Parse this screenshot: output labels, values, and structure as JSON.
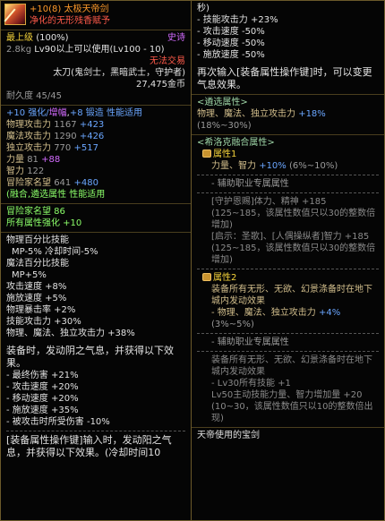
{
  "item": {
    "name": "+10(8) 太极天帝剑",
    "subtitle": "净化的无形残香赋予",
    "level_label": "最上级",
    "level_pct": "(100%)",
    "rarity": "史诗",
    "weight": "2.8kg",
    "use_req": "Lv90以上可以使用(Lv100 - 10)",
    "trade": "无法交易",
    "weapon_type": "太刀(鬼剑士，黑暗武士，守护者)",
    "price": "27,475金币",
    "durability": "耐久度 45/45"
  },
  "enhance": {
    "line1_a": "+10 强化/",
    "line1_b": "增幅",
    "line1_c": ",",
    "line1_d": "+8 锻造",
    "line1_e": " 性能适用",
    "stats": [
      {
        "name": "物理攻击力",
        "base": "1167",
        "bonus": "+423"
      },
      {
        "name": "魔法攻击力",
        "base": "1290",
        "bonus": "+426"
      },
      {
        "name": "独立攻击力",
        "base": "770",
        "bonus": "+517"
      },
      {
        "name": "力量",
        "base": "81",
        "bonus": "+88"
      },
      {
        "name": "智力",
        "base": "122",
        "bonus": ""
      },
      {
        "name": "冒险家名望",
        "base": "641",
        "bonus": "+480"
      }
    ],
    "fusion_note": "(融合,遴选属性 性能适用"
  },
  "fame": {
    "line1": "冒险家名望 86",
    "line2": "所有属性强化 +10"
  },
  "skills": {
    "lines": [
      "物理百分比技能",
      "  MP-5% 冷却时间-5%",
      "魔法百分比技能",
      "  MP+5%",
      "攻击速度 +8%",
      "施放速度 +5%",
      "物理暴击率 +2%",
      "技能攻击力 +30%",
      "物理、魔法、独立攻击力 +38%"
    ],
    "equip_header": "装备时，发动阴之气息，并获得以下效果。",
    "equip_lines": [
      "- 最终伤害 +21%",
      "- 攻击速度 +20%",
      "- 移动速度 +20%",
      "- 施放速度 +35%",
      "- 被攻击时所受伤害 -10%"
    ],
    "bottom": "[装备属性操作键]输入时，发动阳之气息，并获得以下效果。(冷却时间10"
  },
  "right": {
    "cont_sec": "秒)",
    "cont_lines": [
      "- 技能攻击力 +23%",
      "- 攻击速度 -50%",
      "- 移动速度 -50%",
      "- 施放速度 -50%"
    ],
    "reinput": "再次输入[装备属性操作键]时，可以变更气息效果。",
    "select_title": "<遴选属性>",
    "select_text": "物理、魔法、独立攻击力",
    "select_val": "+18%",
    "select_range": "(18%~30%)",
    "fusion_title": "<希洛克融合属性>",
    "attr1_title": "属性1",
    "attr1_text": "力量、智力",
    "attr1_val": "+10%",
    "attr1_range": "(6%~10%)",
    "aux_title1": "- 辅助职业专属属性",
    "aux1_lines": [
      "[守护恩赐]体力、精神 +185 (125~185，该属性数值只以30的整数倍增加)",
      "[启示：圣歌]、[人偶操纵者]智力 +185 (125~185，该属性数值只以30的整数倍增加)"
    ],
    "attr2_title": "属性2",
    "attr2_text": "装备所有无形、无欲、幻景涤备时在地下城内发动效果",
    "attr2_sub": "- 物理、魔法、独立攻击力",
    "attr2_val": "+4%",
    "attr2_range": "(3%~5%)",
    "aux_title2": "- 辅助职业专属属性",
    "aux2_lines": [
      "装备所有无形、无欲、幻景涤备时在地下城内发动效果",
      "- Lv30所有技能 +1",
      "Lv50主动技能力量、智力增加量 +20 (10~30，该属性数值只以10的整数倍出现)"
    ],
    "footer": "天帝使用的宝剑"
  },
  "colors": {
    "name": "#f5d33a",
    "subtitle": "#ff9a2a",
    "bonus_blue": "#6aa6ff",
    "bonus_purple": "#d36bff",
    "border": "#6b5a2a"
  }
}
